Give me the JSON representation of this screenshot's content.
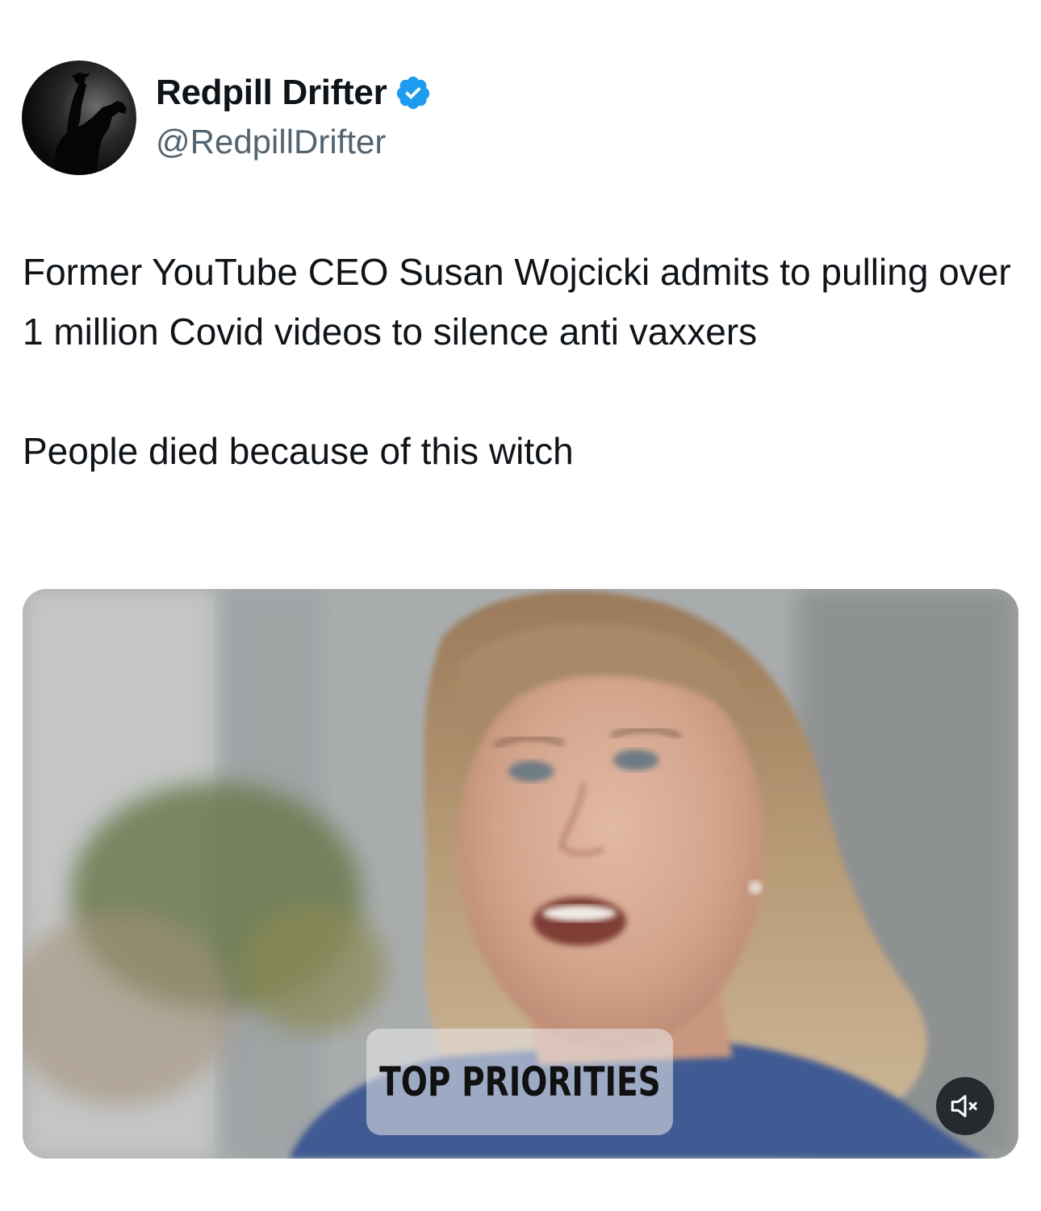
{
  "author": {
    "display_name": "Redpill Drifter",
    "handle": "@RedpillDrifter",
    "verified": true,
    "verified_color": "#1d9bf0"
  },
  "tweet": {
    "paragraph1": "Former YouTube CEO Susan Wojcicki admits to pulling over 1 million Covid videos to silence anti vaxxers",
    "paragraph2": "People died because of this witch"
  },
  "media": {
    "type": "video",
    "caption": "TOP PRIORITIES",
    "muted": true,
    "mute_icon": "speaker-muted-icon"
  },
  "colors": {
    "text": "#0f1419",
    "secondary_text": "#536471"
  }
}
